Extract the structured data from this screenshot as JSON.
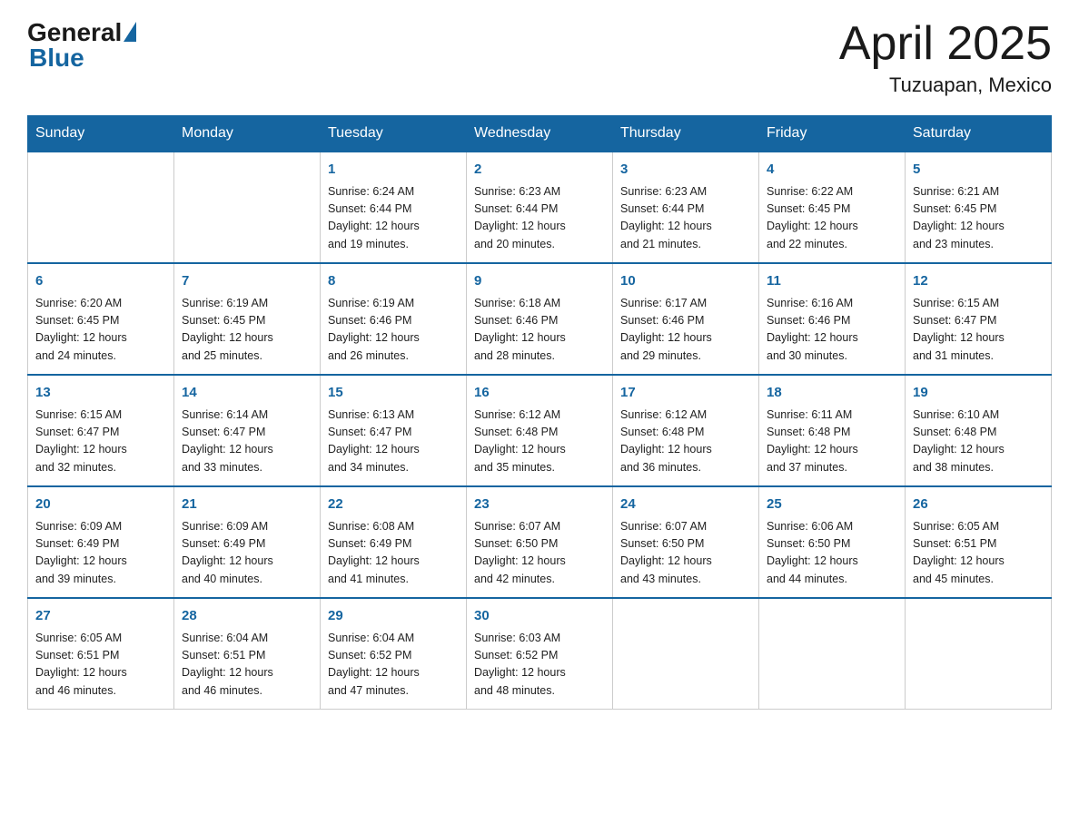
{
  "header": {
    "logo_general": "General",
    "logo_blue": "Blue",
    "month_title": "April 2025",
    "location": "Tuzuapan, Mexico"
  },
  "weekdays": [
    "Sunday",
    "Monday",
    "Tuesday",
    "Wednesday",
    "Thursday",
    "Friday",
    "Saturday"
  ],
  "weeks": [
    [
      {
        "day": "",
        "info": ""
      },
      {
        "day": "",
        "info": ""
      },
      {
        "day": "1",
        "info": "Sunrise: 6:24 AM\nSunset: 6:44 PM\nDaylight: 12 hours\nand 19 minutes."
      },
      {
        "day": "2",
        "info": "Sunrise: 6:23 AM\nSunset: 6:44 PM\nDaylight: 12 hours\nand 20 minutes."
      },
      {
        "day": "3",
        "info": "Sunrise: 6:23 AM\nSunset: 6:44 PM\nDaylight: 12 hours\nand 21 minutes."
      },
      {
        "day": "4",
        "info": "Sunrise: 6:22 AM\nSunset: 6:45 PM\nDaylight: 12 hours\nand 22 minutes."
      },
      {
        "day": "5",
        "info": "Sunrise: 6:21 AM\nSunset: 6:45 PM\nDaylight: 12 hours\nand 23 minutes."
      }
    ],
    [
      {
        "day": "6",
        "info": "Sunrise: 6:20 AM\nSunset: 6:45 PM\nDaylight: 12 hours\nand 24 minutes."
      },
      {
        "day": "7",
        "info": "Sunrise: 6:19 AM\nSunset: 6:45 PM\nDaylight: 12 hours\nand 25 minutes."
      },
      {
        "day": "8",
        "info": "Sunrise: 6:19 AM\nSunset: 6:46 PM\nDaylight: 12 hours\nand 26 minutes."
      },
      {
        "day": "9",
        "info": "Sunrise: 6:18 AM\nSunset: 6:46 PM\nDaylight: 12 hours\nand 28 minutes."
      },
      {
        "day": "10",
        "info": "Sunrise: 6:17 AM\nSunset: 6:46 PM\nDaylight: 12 hours\nand 29 minutes."
      },
      {
        "day": "11",
        "info": "Sunrise: 6:16 AM\nSunset: 6:46 PM\nDaylight: 12 hours\nand 30 minutes."
      },
      {
        "day": "12",
        "info": "Sunrise: 6:15 AM\nSunset: 6:47 PM\nDaylight: 12 hours\nand 31 minutes."
      }
    ],
    [
      {
        "day": "13",
        "info": "Sunrise: 6:15 AM\nSunset: 6:47 PM\nDaylight: 12 hours\nand 32 minutes."
      },
      {
        "day": "14",
        "info": "Sunrise: 6:14 AM\nSunset: 6:47 PM\nDaylight: 12 hours\nand 33 minutes."
      },
      {
        "day": "15",
        "info": "Sunrise: 6:13 AM\nSunset: 6:47 PM\nDaylight: 12 hours\nand 34 minutes."
      },
      {
        "day": "16",
        "info": "Sunrise: 6:12 AM\nSunset: 6:48 PM\nDaylight: 12 hours\nand 35 minutes."
      },
      {
        "day": "17",
        "info": "Sunrise: 6:12 AM\nSunset: 6:48 PM\nDaylight: 12 hours\nand 36 minutes."
      },
      {
        "day": "18",
        "info": "Sunrise: 6:11 AM\nSunset: 6:48 PM\nDaylight: 12 hours\nand 37 minutes."
      },
      {
        "day": "19",
        "info": "Sunrise: 6:10 AM\nSunset: 6:48 PM\nDaylight: 12 hours\nand 38 minutes."
      }
    ],
    [
      {
        "day": "20",
        "info": "Sunrise: 6:09 AM\nSunset: 6:49 PM\nDaylight: 12 hours\nand 39 minutes."
      },
      {
        "day": "21",
        "info": "Sunrise: 6:09 AM\nSunset: 6:49 PM\nDaylight: 12 hours\nand 40 minutes."
      },
      {
        "day": "22",
        "info": "Sunrise: 6:08 AM\nSunset: 6:49 PM\nDaylight: 12 hours\nand 41 minutes."
      },
      {
        "day": "23",
        "info": "Sunrise: 6:07 AM\nSunset: 6:50 PM\nDaylight: 12 hours\nand 42 minutes."
      },
      {
        "day": "24",
        "info": "Sunrise: 6:07 AM\nSunset: 6:50 PM\nDaylight: 12 hours\nand 43 minutes."
      },
      {
        "day": "25",
        "info": "Sunrise: 6:06 AM\nSunset: 6:50 PM\nDaylight: 12 hours\nand 44 minutes."
      },
      {
        "day": "26",
        "info": "Sunrise: 6:05 AM\nSunset: 6:51 PM\nDaylight: 12 hours\nand 45 minutes."
      }
    ],
    [
      {
        "day": "27",
        "info": "Sunrise: 6:05 AM\nSunset: 6:51 PM\nDaylight: 12 hours\nand 46 minutes."
      },
      {
        "day": "28",
        "info": "Sunrise: 6:04 AM\nSunset: 6:51 PM\nDaylight: 12 hours\nand 46 minutes."
      },
      {
        "day": "29",
        "info": "Sunrise: 6:04 AM\nSunset: 6:52 PM\nDaylight: 12 hours\nand 47 minutes."
      },
      {
        "day": "30",
        "info": "Sunrise: 6:03 AM\nSunset: 6:52 PM\nDaylight: 12 hours\nand 48 minutes."
      },
      {
        "day": "",
        "info": ""
      },
      {
        "day": "",
        "info": ""
      },
      {
        "day": "",
        "info": ""
      }
    ]
  ]
}
